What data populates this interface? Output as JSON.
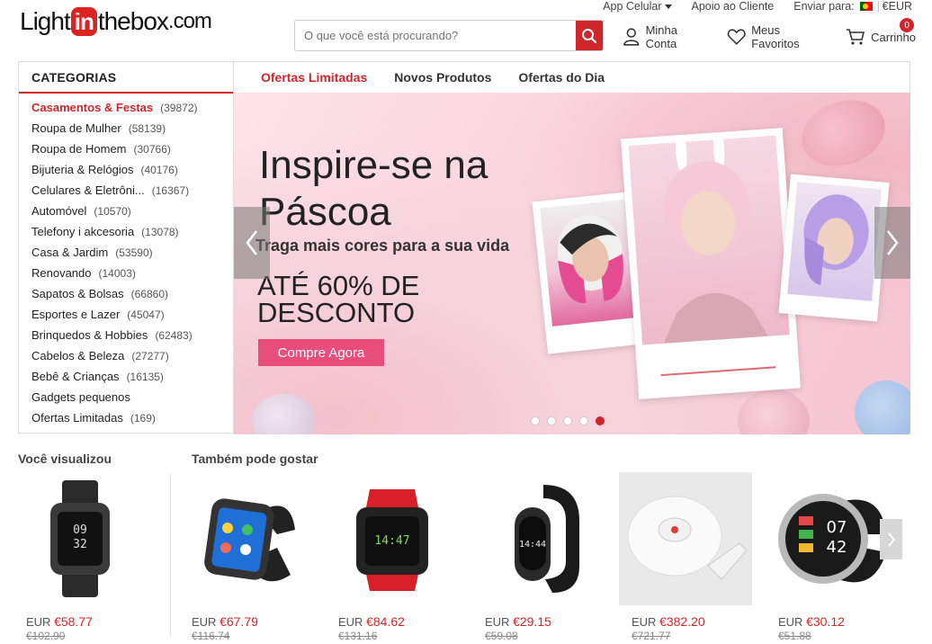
{
  "topbar": {
    "app_label": "App Celular",
    "support_label": "Apoio ao Cliente",
    "ship_label": "Enviar para:",
    "currency": "€EUR"
  },
  "logo": {
    "part1": "Light",
    "part2": "in",
    "part3": "thebox",
    "part4": ".com"
  },
  "search": {
    "placeholder": "O que você está procurando?"
  },
  "header": {
    "account": "Minha Conta",
    "favorites": "Meus Favoritos",
    "cart": "Carrinho",
    "cart_count": "0"
  },
  "categories": {
    "title": "CATEGORIAS",
    "items": [
      {
        "label": "Casamentos & Festas",
        "count": "(39872)"
      },
      {
        "label": "Roupa de Mulher",
        "count": "(58139)"
      },
      {
        "label": "Roupa de Homem",
        "count": "(30766)"
      },
      {
        "label": "Bijuteria & Relógios",
        "count": "(40176)"
      },
      {
        "label": "Celulares & Eletrôni...",
        "count": "(16367)"
      },
      {
        "label": "Automóvel",
        "count": "(10570)"
      },
      {
        "label": "Telefony i akcesoria",
        "count": "(13078)"
      },
      {
        "label": "Casa & Jardim",
        "count": "(53590)"
      },
      {
        "label": "Renovando",
        "count": "(14003)"
      },
      {
        "label": "Sapatos & Bolsas",
        "count": "(66860)"
      },
      {
        "label": "Esportes e Lazer",
        "count": "(45047)"
      },
      {
        "label": "Brinquedos & Hobbies",
        "count": "(62483)"
      },
      {
        "label": "Cabelos & Beleza",
        "count": "(27277)"
      },
      {
        "label": "Bebê & Crianças",
        "count": "(16135)"
      },
      {
        "label": "Gadgets pequenos",
        "count": ""
      },
      {
        "label": "Ofertas Limitadas",
        "count": "(169)"
      }
    ]
  },
  "tabs": [
    "Ofertas Limitadas",
    "Novos Produtos",
    "Ofertas do Dia"
  ],
  "banner": {
    "title": "Inspire-se na Páscoa",
    "subtitle": "Traga mais cores para a sua vida",
    "discount": "ATÉ 60% DE DESCONTO",
    "cta": "Compre Agora",
    "active_slide": 5,
    "slide_count": 5
  },
  "viewed": {
    "title": "Você visualizou",
    "product": {
      "currency": "EUR",
      "price": "€58.77",
      "old_price": "€102.90"
    }
  },
  "recommended": {
    "title": "Também pode gostar",
    "products": [
      {
        "currency": "EUR",
        "price": "€67.79",
        "old_price": "€116.74"
      },
      {
        "currency": "EUR",
        "price": "€84.62",
        "old_price": "€131.16"
      },
      {
        "currency": "EUR",
        "price": "€29.15",
        "old_price": "€59.08"
      },
      {
        "currency": "EUR",
        "price": "€382.20",
        "old_price": "€721.77"
      },
      {
        "currency": "EUR",
        "price": "€30.12",
        "old_price": "€51.88"
      }
    ]
  },
  "colors": {
    "brand_red": "#d0262b",
    "banner_pink": "#e94d7a"
  }
}
